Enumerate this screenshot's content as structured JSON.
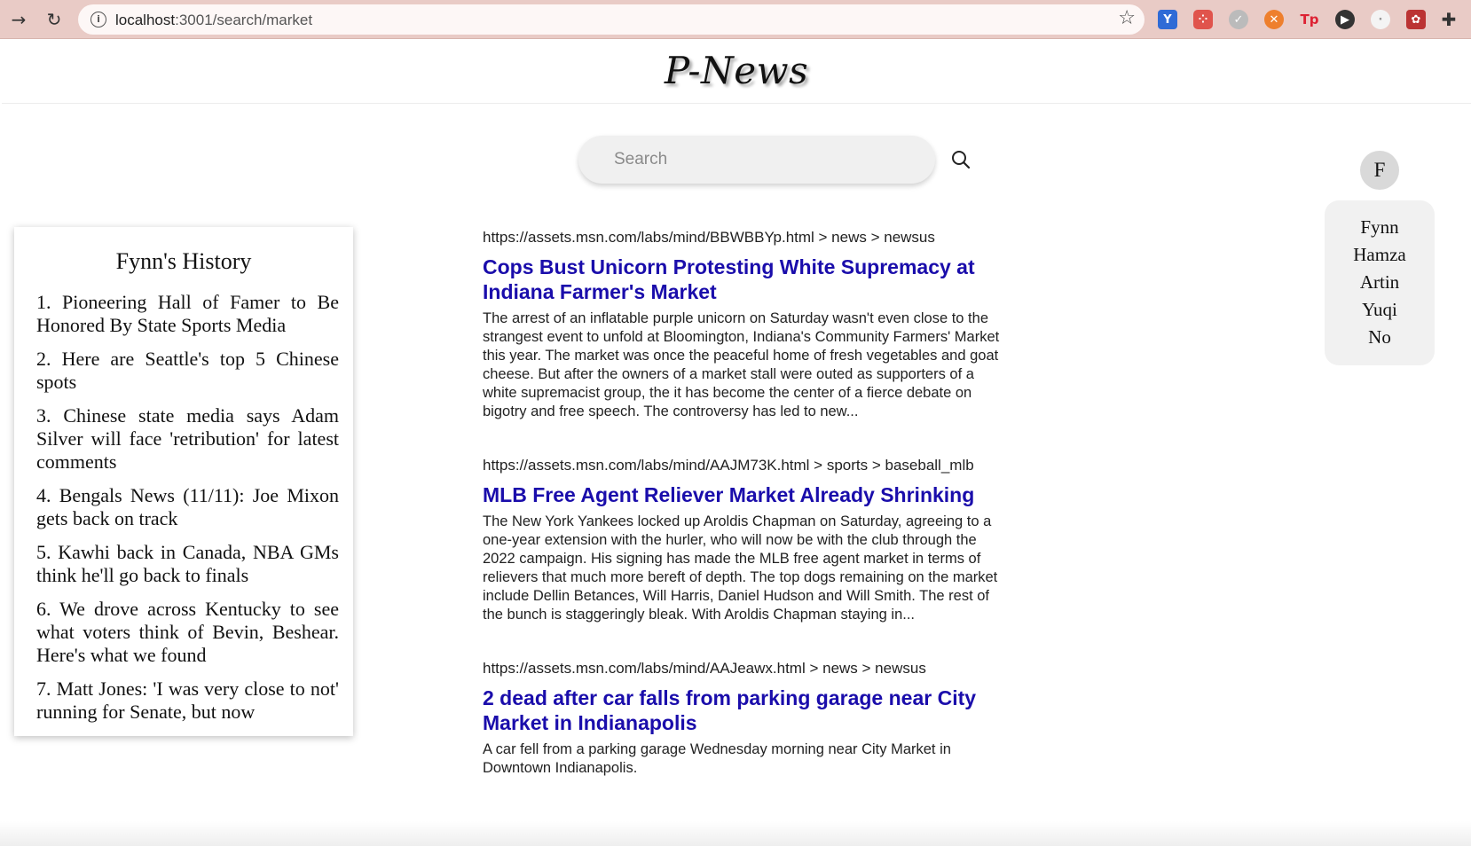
{
  "browser": {
    "url_host": "localhost",
    "url_path": ":3001/search/market"
  },
  "app": {
    "logo": "P-News"
  },
  "search": {
    "placeholder": "Search"
  },
  "history": {
    "title": "Fynn's History",
    "items": [
      "1. Pioneering Hall of Famer to Be Honored By State Sports Media",
      "2. Here are Seattle's top 5 Chinese spots",
      "3. Chinese state media says Adam Silver will face 'retribution' for latest comments",
      "4. Bengals News (11/11): Joe Mixon gets back on track",
      "5. Kawhi back in Canada, NBA GMs think he'll go back to finals",
      "6. We drove across Kentucky to see what voters think of Bevin, Beshear. Here's what we found",
      "7. Matt Jones: 'I was very close to not' running for Senate, but now"
    ]
  },
  "results": [
    {
      "crumb": "https://assets.msn.com/labs/mind/BBWBBYp.html > news > newsus",
      "title": "Cops Bust Unicorn Protesting White Supremacy at Indiana Farmer's Market",
      "snippet": "The arrest of an inflatable purple unicorn on Saturday wasn't even close to the strangest event to unfold at Bloomington, Indiana's Community Farmers' Market this year. The market was once the peaceful home of fresh vegetables and goat cheese. But after the owners of a market stall were outed as supporters of a white supremacist group, the it has become the center of a fierce debate on bigotry and free speech. The controversy has led to new..."
    },
    {
      "crumb": "https://assets.msn.com/labs/mind/AAJM73K.html > sports > baseball_mlb",
      "title": "MLB Free Agent Reliever Market Already Shrinking",
      "snippet": "The New York Yankees locked up Aroldis Chapman on Saturday, agreeing to a one-year extension with the hurler, who will now be with the club through the 2022 campaign. His signing has made the MLB free agent market in terms of relievers that much more bereft of depth. The top dogs remaining on the market include Dellin Betances, Will Harris, Daniel Hudson and Will Smith. The rest of the bunch is staggeringly bleak. With Aroldis Chapman staying in..."
    },
    {
      "crumb": "https://assets.msn.com/labs/mind/AAJeawx.html > news > newsus",
      "title": "2 dead after car falls from parking garage near City Market in Indianapolis",
      "snippet": "A car fell from a parking garage Wednesday morning near City Market in Downtown Indianapolis."
    }
  ],
  "user": {
    "avatar_letter": "F",
    "options": [
      "Fynn",
      "Hamza",
      "Artin",
      "Yuqi",
      "No"
    ]
  },
  "colors": {
    "link": "#1a0dab",
    "chrome": "#e9cbc6"
  }
}
